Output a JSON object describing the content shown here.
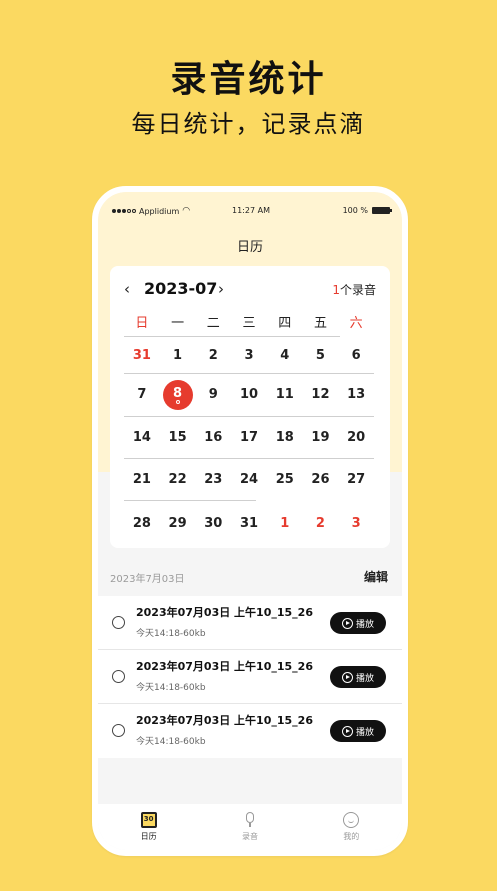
{
  "hero": {
    "title": "录音统计",
    "subtitle": "每日统计，记录点滴"
  },
  "status_bar": {
    "carrier": "Applidium",
    "time": "11:27 AM",
    "battery": "100 %"
  },
  "nav": {
    "title": "日历"
  },
  "calendar": {
    "prev_label": "‹",
    "next_label": "›",
    "month": "2023-07",
    "record_count": "1",
    "record_suffix": "个录音",
    "weekdays": [
      "日",
      "一",
      "二",
      "三",
      "四",
      "五",
      "六"
    ],
    "weeks": [
      [
        "31",
        "1",
        "2",
        "3",
        "4",
        "5",
        "6"
      ],
      [
        "7",
        "8",
        "9",
        "10",
        "11",
        "12",
        "13"
      ],
      [
        "14",
        "15",
        "16",
        "17",
        "18",
        "19",
        "20"
      ],
      [
        "21",
        "22",
        "23",
        "24",
        "25",
        "26",
        "27"
      ],
      [
        "28",
        "29",
        "30",
        "31",
        "1",
        "2",
        "3"
      ]
    ],
    "selected_day": "8",
    "accent_color": "#E63B2E"
  },
  "list": {
    "section_date": "2023年7月03日",
    "edit_label": "编辑",
    "records": [
      {
        "title": "2023年07月03日 上午10_15_26",
        "meta": "今天14:18-60kb",
        "play_label": "播放"
      },
      {
        "title": "2023年07月03日 上午10_15_26",
        "meta": "今天14:18-60kb",
        "play_label": "播放"
      },
      {
        "title": "2023年07月03日 上午10_15_26",
        "meta": "今天14:18-60kb",
        "play_label": "播放"
      }
    ]
  },
  "tabs": [
    {
      "label": "日历",
      "icon": "calendar-icon",
      "icon_text": "30",
      "active": true
    },
    {
      "label": "录音",
      "icon": "microphone-icon",
      "active": false
    },
    {
      "label": "我的",
      "icon": "smile-icon",
      "active": false
    }
  ]
}
